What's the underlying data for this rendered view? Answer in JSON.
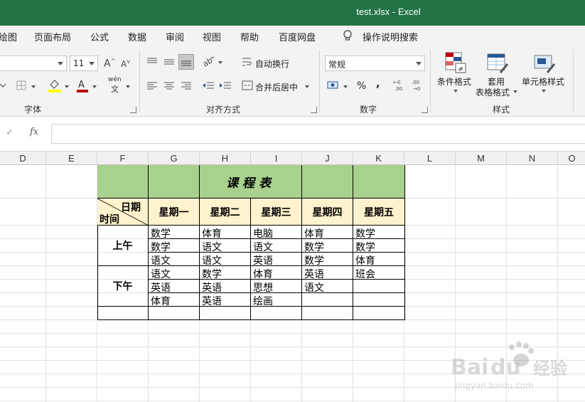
{
  "window": {
    "title": "test.xlsx  -  Excel"
  },
  "menu": {
    "tabs": [
      "绘图",
      "页面布局",
      "公式",
      "数据",
      "审阅",
      "视图",
      "帮助",
      "百度网盘"
    ],
    "search_label": "操作说明搜索"
  },
  "ribbon": {
    "font_name_value": "",
    "font_size_value": "11",
    "grow_font": "A",
    "shrink_font": "A",
    "phonetic_top": "wén",
    "phonetic_bottom": "文",
    "wrap_text": "自动换行",
    "merge_center": "合并后居中",
    "number_format_value": "常规",
    "percent": "%",
    "comma": ",",
    "conditional_format": "条件格式",
    "table_format_1": "套用",
    "table_format_2": "表格格式",
    "cell_styles": "单元格样式",
    "groups": {
      "font": "字体",
      "alignment": "对齐方式",
      "number": "数字",
      "styles": "样式"
    },
    "font_color": "#c00000",
    "fill_color": "#ffff00"
  },
  "formula_bar": {
    "fx": "fx",
    "check": "✓",
    "value": ""
  },
  "columns": [
    "D",
    "E",
    "F",
    "G",
    "H",
    "I",
    "J",
    "K",
    "L",
    "M",
    "N",
    "O"
  ],
  "sheet": {
    "title": "课程表",
    "header_corner_top": "日期",
    "header_corner_bottom": "时间",
    "days": [
      "星期一",
      "星期二",
      "星期三",
      "星期四",
      "星期五"
    ],
    "periods": [
      "上午",
      "下午"
    ],
    "rows": [
      [
        "数学",
        "体育",
        "电脑",
        "体育",
        "数学"
      ],
      [
        "数学",
        "语文",
        "语文",
        "数学",
        "数学"
      ],
      [
        "语文",
        "语文",
        "英语",
        "数学",
        "体育"
      ],
      [
        "语文",
        "数学",
        "体育",
        "英语",
        "班会"
      ],
      [
        "英语",
        "英语",
        "思想",
        "语文",
        ""
      ],
      [
        "体育",
        "英语",
        "绘画",
        "",
        ""
      ]
    ],
    "colors": {
      "title_fill": "#a9d18e",
      "header_fill": "#fff2cc"
    }
  },
  "watermark": {
    "brand": "Bai",
    "brand2": "经验",
    "url": "jingyan.baidu.com"
  }
}
